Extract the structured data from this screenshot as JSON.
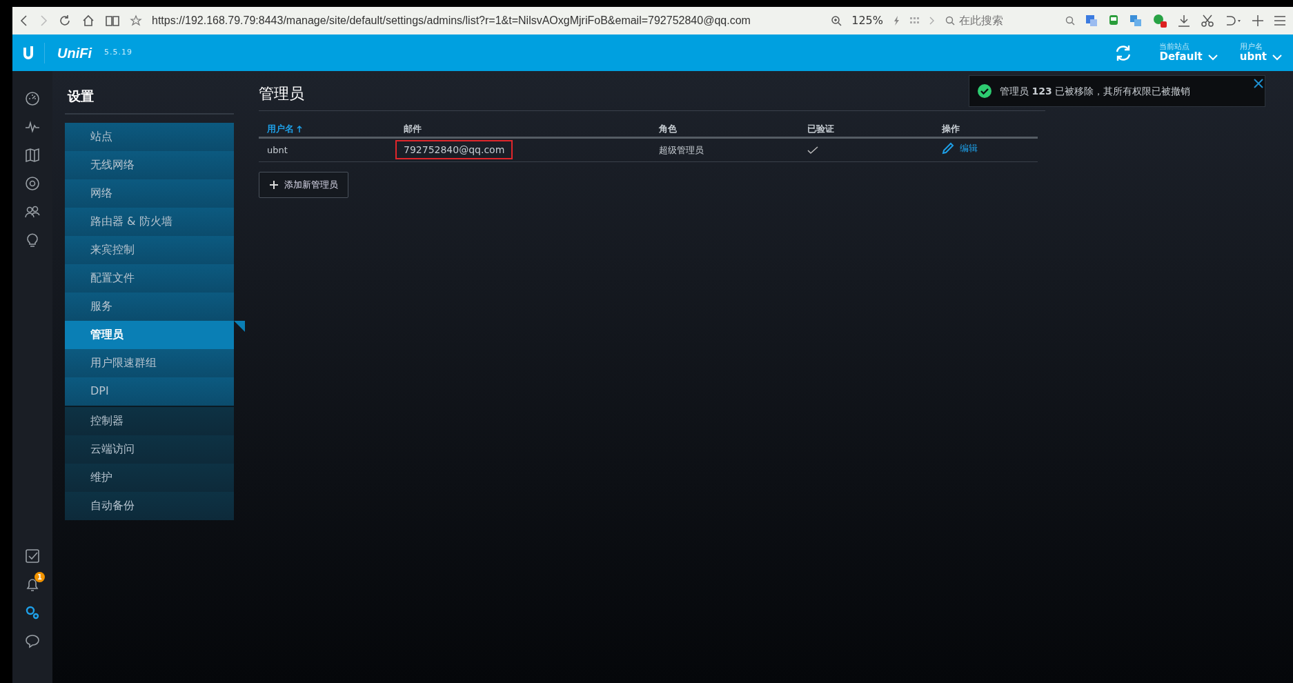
{
  "browser": {
    "url": "https://192.168.79.79:8443/manage/site/default/settings/admins/list?r=1&t=NilsvAOxgMjriFoB&email=792752840@qq.com",
    "zoom": "125%",
    "search_placeholder": "在此搜索"
  },
  "header": {
    "logo": "UniFi",
    "version": "5.5.19",
    "site_label": "当前站点",
    "site": "Default",
    "user_label": "用户名",
    "user": "ubnt"
  },
  "nav_top": [
    {
      "kind": "dashboard",
      "selected": false
    },
    {
      "kind": "statistics",
      "selected": false
    },
    {
      "kind": "map",
      "selected": false
    },
    {
      "kind": "devices",
      "selected": false
    },
    {
      "kind": "clients",
      "selected": false
    },
    {
      "kind": "insights",
      "selected": false
    }
  ],
  "nav_bottom": [
    {
      "kind": "tasks",
      "selected": false
    },
    {
      "kind": "alerts",
      "selected": false,
      "badge": "1"
    },
    {
      "kind": "settings",
      "selected": true
    },
    {
      "kind": "chat",
      "selected": false
    }
  ],
  "settings_menu": {
    "title": "设置",
    "groups": [
      [
        {
          "label": "站点",
          "selected": false
        },
        {
          "label": "无线网络",
          "selected": false
        },
        {
          "label": "网络",
          "selected": false
        },
        {
          "label": "路由器 & 防火墙",
          "selected": false
        },
        {
          "label": "来宾控制",
          "selected": false
        },
        {
          "label": "配置文件",
          "selected": false
        },
        {
          "label": "服务",
          "selected": false
        },
        {
          "label": "管理员",
          "selected": true
        },
        {
          "label": "用户限速群组",
          "selected": false
        },
        {
          "label": "DPI",
          "selected": false
        }
      ],
      [
        {
          "label": "控制器",
          "selected": false
        },
        {
          "label": "云端访问",
          "selected": false
        },
        {
          "label": "维护",
          "selected": false
        },
        {
          "label": "自动备份",
          "selected": false
        }
      ]
    ]
  },
  "page_title": "管理员",
  "table": {
    "columns": [
      {
        "label": "用户名",
        "sorted": true
      },
      {
        "label": "邮件",
        "sorted": false
      },
      {
        "label": "角色",
        "sorted": false
      },
      {
        "label": "已验证",
        "sorted": false
      },
      {
        "label": "操作",
        "sorted": false
      }
    ],
    "rows": [
      {
        "username": "ubnt",
        "email": "792752840@qq.com",
        "email_highlighted": true,
        "role": "超级管理员",
        "verified": true,
        "action": "编辑"
      }
    ]
  },
  "add_button": "添加新管理员",
  "toast": {
    "message": "管理员 **123** 已被移除，其所有权限已被撤销"
  }
}
